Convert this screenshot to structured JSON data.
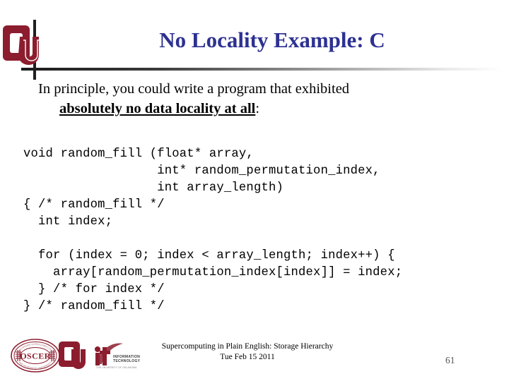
{
  "slide": {
    "title": "No Locality Example: C",
    "title_color": "#2d3191"
  },
  "body": {
    "line1": "In principle, you could write a program that exhibited",
    "line2_emphasis": "absolutely no data locality at all",
    "line2_tail": ":"
  },
  "code": {
    "language": "C",
    "lines": [
      "void random_fill (float* array,",
      "                  int* random_permutation_index,",
      "                  int array_length)",
      "{ /* random_fill */",
      "  int index;",
      "",
      "  for (index = 0; index < array_length; index++) {",
      "    array[random_permutation_index[index]] = index;",
      "  } /* for index */",
      "} /* random_fill */"
    ]
  },
  "footer": {
    "title_line": "Supercomputing in Plain English: Storage Hierarchy",
    "date_line": "Tue Feb 15 2011",
    "page_number": "61",
    "logos": [
      {
        "name": "oscer-seal-logo",
        "text": "OSCER"
      },
      {
        "name": "ou-logo",
        "text": "OU"
      },
      {
        "name": "ou-it-logo",
        "text": "it",
        "sub1": "INFORMATION",
        "sub2": "TECHNOLOGY",
        "sub3": "THE UNIVERSITY OF OKLAHOMA"
      }
    ]
  },
  "colors": {
    "crimson": "#8c1d2e",
    "navy": "#2d3191",
    "rule": "#231f20"
  }
}
